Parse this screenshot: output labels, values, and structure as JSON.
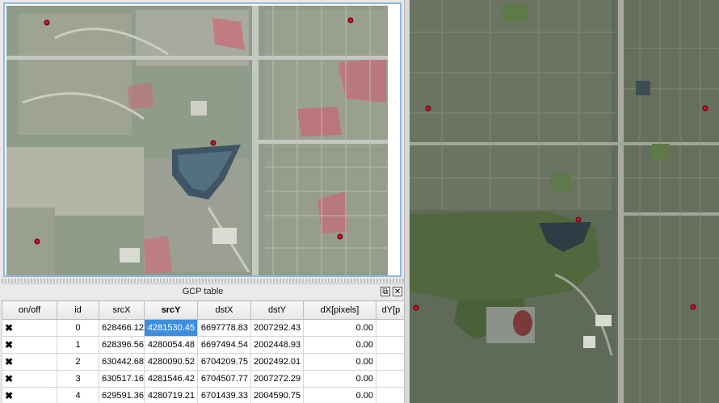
{
  "dock": {
    "title": "GCP table",
    "float_icon": "⧉",
    "close_icon": "✕"
  },
  "table": {
    "columns": [
      "on/off",
      "id",
      "srcX",
      "srcY",
      "dstX",
      "dstY",
      "dX[pixels]",
      "dY[p"
    ],
    "sorted_column": "srcY",
    "rows": [
      {
        "enabled": "✖",
        "id": "0",
        "srcX": "628466.12",
        "srcY": "4281530.45",
        "dstX": "6697778.83",
        "dstY": "2007292.43",
        "dX": "0.00"
      },
      {
        "enabled": "✖",
        "id": "1",
        "srcX": "628396.56",
        "srcY": "4280054.48",
        "dstX": "6697494.54",
        "dstY": "2002448.93",
        "dX": "0.00"
      },
      {
        "enabled": "✖",
        "id": "2",
        "srcX": "630442.68",
        "srcY": "4280090.52",
        "dstX": "6704209.75",
        "dstY": "2002492.01",
        "dX": "0.00"
      },
      {
        "enabled": "✖",
        "id": "3",
        "srcX": "630517.16",
        "srcY": "4281546.42",
        "dstX": "6704507.77",
        "dstY": "2007272.29",
        "dX": "0.00"
      },
      {
        "enabled": "✖",
        "id": "4",
        "srcX": "629591.36",
        "srcY": "4280719.21",
        "dstX": "6701439.33",
        "dstY": "2004590.75",
        "dX": "0.00"
      }
    ]
  },
  "colors": {
    "gcp_marker": "#c8102e",
    "selection": "#3d8ee0",
    "frame_border": "#8fb8e0"
  }
}
